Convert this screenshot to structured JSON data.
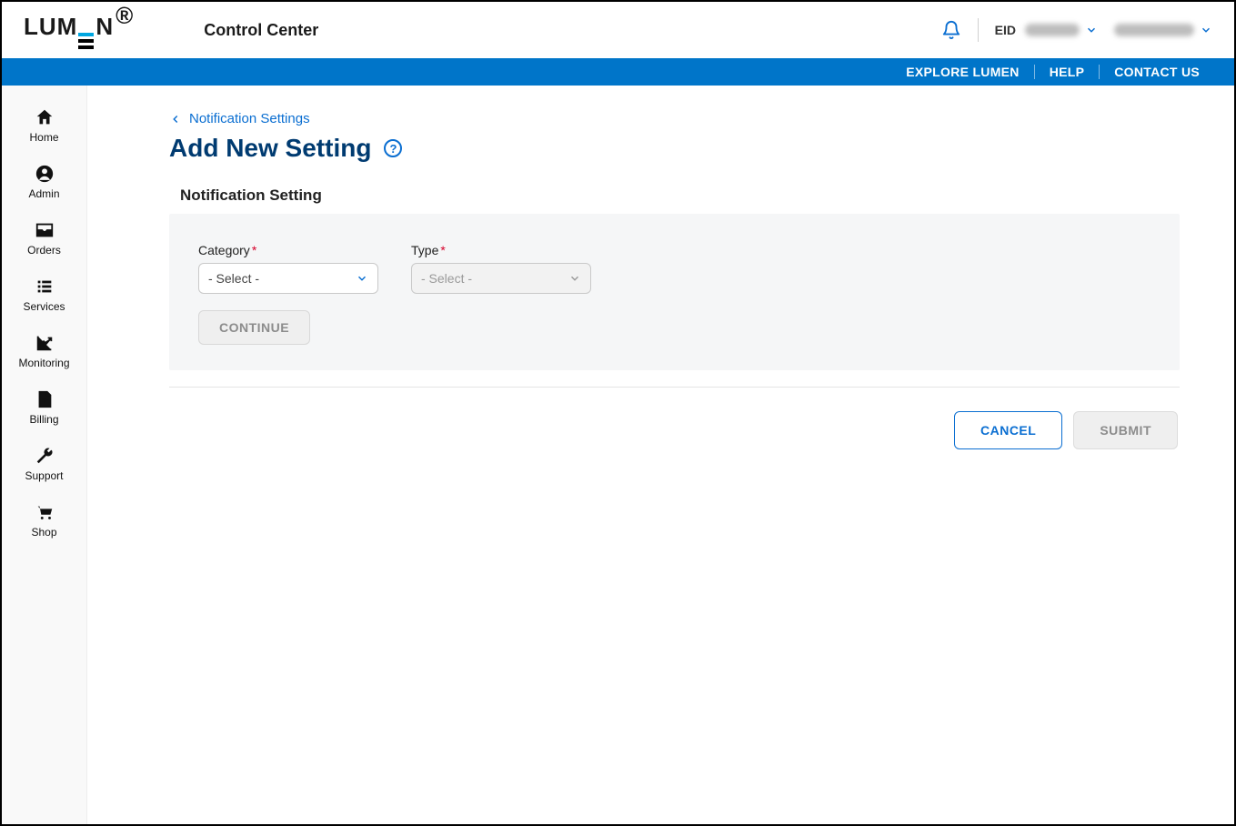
{
  "header": {
    "app_title": "Control Center",
    "eid_label": "EID",
    "logo_text": {
      "l": "L",
      "u": "U",
      "m": "M",
      "n": "N"
    }
  },
  "bluebar": {
    "explore": "EXPLORE LUMEN",
    "help": "HELP",
    "contact": "CONTACT US"
  },
  "sidebar": {
    "items": [
      {
        "label": "Home"
      },
      {
        "label": "Admin"
      },
      {
        "label": "Orders"
      },
      {
        "label": "Services"
      },
      {
        "label": "Monitoring"
      },
      {
        "label": "Billing"
      },
      {
        "label": "Support"
      },
      {
        "label": "Shop"
      }
    ]
  },
  "breadcrumb": {
    "label": "Notification Settings"
  },
  "page": {
    "title": "Add New Setting",
    "panel_heading": "Notification Setting",
    "category_label": "Category",
    "type_label": "Type",
    "category_value": "- Select -",
    "type_value": "- Select -",
    "continue": "CONTINUE",
    "cancel": "CANCEL",
    "submit": "SUBMIT"
  }
}
